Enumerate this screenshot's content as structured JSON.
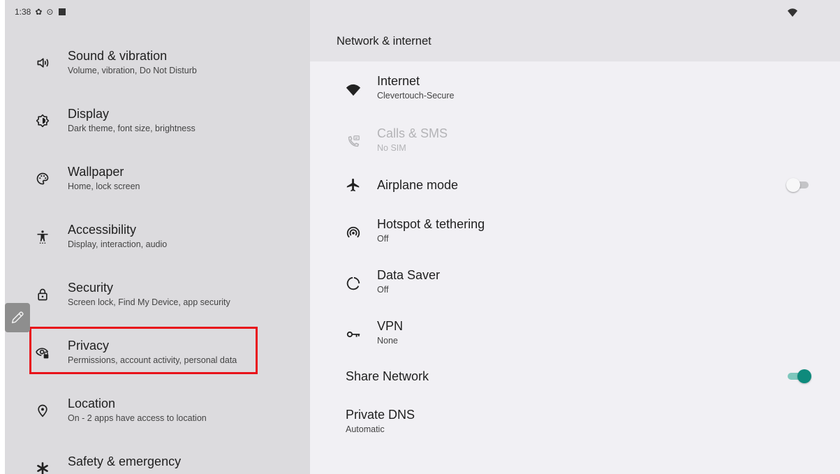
{
  "status_bar": {
    "time": "1:38",
    "icons": [
      "settings-gear-icon",
      "circle-dot-icon",
      "square-icon"
    ]
  },
  "sidebar": {
    "items": [
      {
        "title": "Sound & vibration",
        "subtitle": "Volume, vibration, Do Not Disturb",
        "icon": "volume-icon"
      },
      {
        "title": "Display",
        "subtitle": "Dark theme, font size, brightness",
        "icon": "display-brightness-icon"
      },
      {
        "title": "Wallpaper",
        "subtitle": "Home, lock screen",
        "icon": "palette-icon"
      },
      {
        "title": "Accessibility",
        "subtitle": "Display, interaction, audio",
        "icon": "accessibility-icon"
      },
      {
        "title": "Security",
        "subtitle": "Screen lock, Find My Device, app security",
        "icon": "lock-icon"
      },
      {
        "title": "Privacy",
        "subtitle": "Permissions, account activity, personal data",
        "icon": "privacy-eye-lock-icon",
        "highlighted": true
      },
      {
        "title": "Location",
        "subtitle": "On - 2 apps have access to location",
        "icon": "location-pin-icon"
      },
      {
        "title": "Safety & emergency",
        "subtitle": "",
        "icon": "asterisk-icon"
      }
    ],
    "highlight_color": "#e8121a"
  },
  "main": {
    "header_title": "Network & internet",
    "rows": [
      {
        "title": "Internet",
        "subtitle": "Clevertouch-Secure",
        "icon": "wifi-icon",
        "enabled": true
      },
      {
        "title": "Calls & SMS",
        "subtitle": "No SIM",
        "icon": "calls-sms-icon",
        "enabled": false
      },
      {
        "title": "Airplane mode",
        "subtitle": "",
        "icon": "airplane-icon",
        "toggle": false
      },
      {
        "title": "Hotspot & tethering",
        "subtitle": "Off",
        "icon": "hotspot-icon"
      },
      {
        "title": "Data Saver",
        "subtitle": "Off",
        "icon": "data-saver-icon"
      },
      {
        "title": "VPN",
        "subtitle": "None",
        "icon": "vpn-key-icon"
      },
      {
        "title": "Share Network",
        "subtitle": "",
        "toggle": true
      },
      {
        "title": "Private DNS",
        "subtitle": "Automatic"
      }
    ]
  },
  "colors": {
    "sidebar_bg": "#dcdbde",
    "content_bg": "#f1f0f4",
    "header_bg": "#e4e3e7",
    "toggle_on": "#0e8a7c"
  }
}
